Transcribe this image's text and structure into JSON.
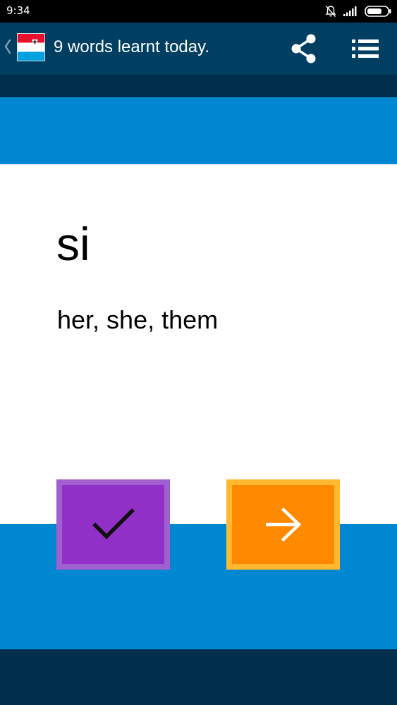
{
  "status_bar": {
    "time": "9:34"
  },
  "app_bar": {
    "title": "9 words learnt today.",
    "back_icon": "chevron-left-icon",
    "flag_icon": "luxembourg-flag-icon",
    "share_icon": "share-icon",
    "list_icon": "list-icon"
  },
  "card": {
    "word": "si",
    "translation": "her, she, them"
  },
  "actions": {
    "know_icon": "checkmark-icon",
    "next_icon": "arrow-right-icon"
  },
  "colors": {
    "status_bar": "#000000",
    "app_bar": "#003E62",
    "dark_band": "#002F4C",
    "blue_band": "#0087D2",
    "card": "#FFFFFF",
    "know_button": "#9030C6",
    "know_border": "#A060D0",
    "next_button": "#FF8A00",
    "next_border": "#FFB830"
  }
}
